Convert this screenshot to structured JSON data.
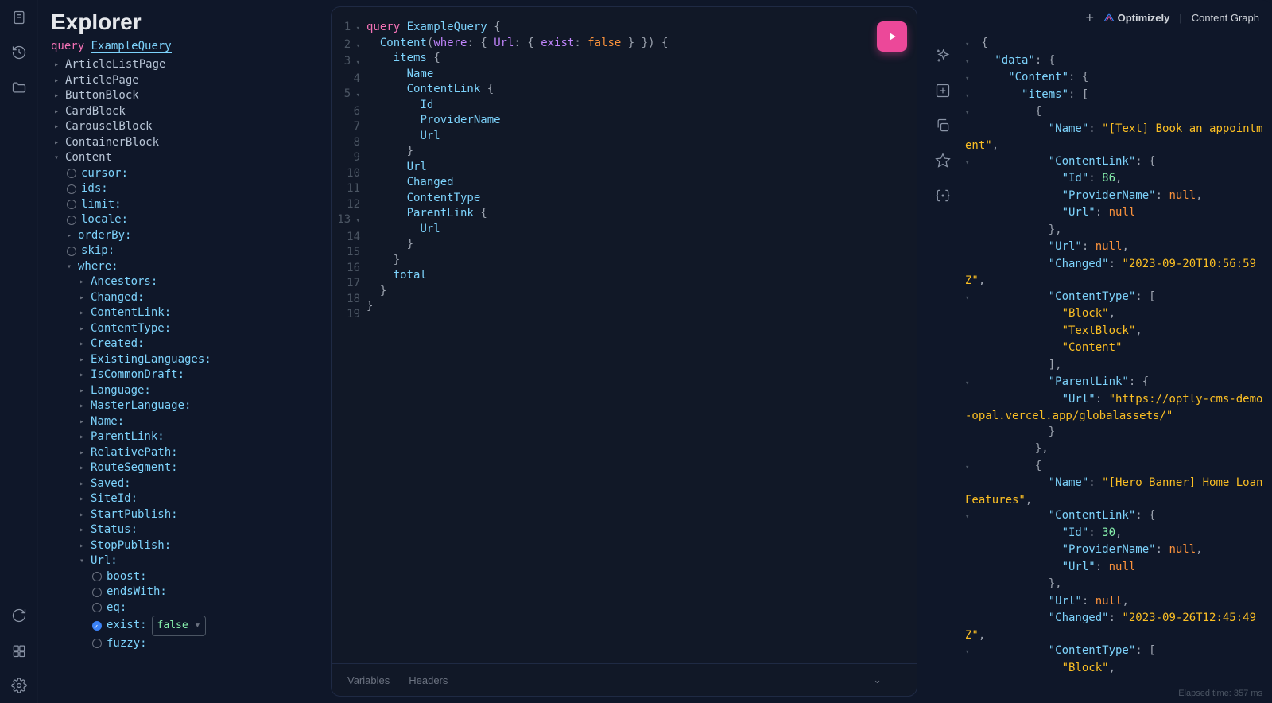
{
  "explorer": {
    "title": "Explorer",
    "query_keyword": "query",
    "query_name": "ExampleQuery",
    "types": [
      "ArticleListPage",
      "ArticlePage",
      "ButtonBlock",
      "CardBlock",
      "CarouselBlock",
      "ContainerBlock"
    ],
    "content_label": "Content",
    "content_args": [
      {
        "name": "cursor:",
        "checked": false
      },
      {
        "name": "ids:",
        "checked": false
      },
      {
        "name": "limit:",
        "checked": false
      },
      {
        "name": "locale:",
        "checked": false
      }
    ],
    "orderby": "orderBy:",
    "skip": {
      "name": "skip:",
      "checked": false
    },
    "where": "where:",
    "where_fields": [
      "Ancestors:",
      "Changed:",
      "ContentLink:",
      "ContentType:",
      "Created:",
      "ExistingLanguages:",
      "IsCommonDraft:",
      "Language:",
      "MasterLanguage:",
      "Name:",
      "ParentLink:",
      "RelativePath:",
      "RouteSegment:",
      "Saved:",
      "SiteId:",
      "StartPublish:",
      "Status:",
      "StopPublish:"
    ],
    "url_label": "Url:",
    "url_sub": [
      {
        "name": "boost:",
        "checked": false
      },
      {
        "name": "endsWith:",
        "checked": false
      },
      {
        "name": "eq:",
        "checked": false
      },
      {
        "name": "exist:",
        "checked": true,
        "value": "false"
      },
      {
        "name": "fuzzy:",
        "checked": false
      }
    ]
  },
  "editor": {
    "lines": [
      {
        "n": "1",
        "fold": true,
        "tokens": [
          {
            "c": "tk-kw",
            "t": "query"
          },
          {
            "c": "",
            "t": " "
          },
          {
            "c": "tk-name",
            "t": "ExampleQuery"
          },
          {
            "c": "",
            "t": " "
          },
          {
            "c": "tk-punc",
            "t": "{"
          }
        ]
      },
      {
        "n": "2",
        "fold": true,
        "tokens": [
          {
            "c": "",
            "t": "  "
          },
          {
            "c": "tk-field",
            "t": "Content"
          },
          {
            "c": "tk-punc",
            "t": "("
          },
          {
            "c": "tk-arg",
            "t": "where"
          },
          {
            "c": "tk-punc",
            "t": ": { "
          },
          {
            "c": "tk-arg",
            "t": "Url"
          },
          {
            "c": "tk-punc",
            "t": ": { "
          },
          {
            "c": "tk-arg",
            "t": "exist"
          },
          {
            "c": "tk-punc",
            "t": ": "
          },
          {
            "c": "tk-bool",
            "t": "false"
          },
          {
            "c": "tk-punc",
            "t": " } }) {"
          }
        ]
      },
      {
        "n": "3",
        "fold": true,
        "tokens": [
          {
            "c": "",
            "t": "    "
          },
          {
            "c": "tk-field",
            "t": "items"
          },
          {
            "c": "",
            "t": " "
          },
          {
            "c": "tk-punc",
            "t": "{"
          }
        ]
      },
      {
        "n": "4",
        "tokens": [
          {
            "c": "",
            "t": "      "
          },
          {
            "c": "tk-field",
            "t": "Name"
          }
        ]
      },
      {
        "n": "5",
        "fold": true,
        "tokens": [
          {
            "c": "",
            "t": "      "
          },
          {
            "c": "tk-field",
            "t": "ContentLink"
          },
          {
            "c": "",
            "t": " "
          },
          {
            "c": "tk-punc",
            "t": "{"
          }
        ]
      },
      {
        "n": "6",
        "tokens": [
          {
            "c": "",
            "t": "        "
          },
          {
            "c": "tk-field",
            "t": "Id"
          }
        ]
      },
      {
        "n": "7",
        "tokens": [
          {
            "c": "",
            "t": "        "
          },
          {
            "c": "tk-field",
            "t": "ProviderName"
          }
        ]
      },
      {
        "n": "8",
        "tokens": [
          {
            "c": "",
            "t": "        "
          },
          {
            "c": "tk-field",
            "t": "Url"
          }
        ]
      },
      {
        "n": "9",
        "tokens": [
          {
            "c": "",
            "t": "      "
          },
          {
            "c": "tk-punc",
            "t": "}"
          }
        ]
      },
      {
        "n": "10",
        "tokens": [
          {
            "c": "",
            "t": "      "
          },
          {
            "c": "tk-field",
            "t": "Url"
          }
        ]
      },
      {
        "n": "11",
        "tokens": [
          {
            "c": "",
            "t": "      "
          },
          {
            "c": "tk-field",
            "t": "Changed"
          }
        ]
      },
      {
        "n": "12",
        "tokens": [
          {
            "c": "",
            "t": "      "
          },
          {
            "c": "tk-field",
            "t": "ContentType"
          }
        ]
      },
      {
        "n": "13",
        "fold": true,
        "tokens": [
          {
            "c": "",
            "t": "      "
          },
          {
            "c": "tk-field",
            "t": "ParentLink"
          },
          {
            "c": "",
            "t": " "
          },
          {
            "c": "tk-punc",
            "t": "{"
          }
        ]
      },
      {
        "n": "14",
        "tokens": [
          {
            "c": "",
            "t": "        "
          },
          {
            "c": "tk-field",
            "t": "Url"
          }
        ]
      },
      {
        "n": "15",
        "tokens": [
          {
            "c": "",
            "t": "      "
          },
          {
            "c": "tk-punc",
            "t": "}"
          }
        ]
      },
      {
        "n": "16",
        "tokens": [
          {
            "c": "",
            "t": "    "
          },
          {
            "c": "tk-punc",
            "t": "}"
          }
        ]
      },
      {
        "n": "17",
        "tokens": [
          {
            "c": "",
            "t": "    "
          },
          {
            "c": "tk-field",
            "t": "total"
          }
        ]
      },
      {
        "n": "18",
        "tokens": [
          {
            "c": "",
            "t": "  "
          },
          {
            "c": "tk-punc",
            "t": "}"
          }
        ]
      },
      {
        "n": "19",
        "tokens": [
          {
            "c": "tk-punc",
            "t": "}"
          }
        ]
      }
    ]
  },
  "bottom": {
    "variables": "Variables",
    "headers": "Headers"
  },
  "branding": {
    "name": "Optimizely",
    "product": "Content Graph"
  },
  "result_lines": [
    [
      {
        "f": "▾"
      },
      {
        "c": "jp",
        "t": " {"
      }
    ],
    [
      {
        "f": "▾"
      },
      {
        "c": "jp",
        "t": "   "
      },
      {
        "c": "jk",
        "t": "\"data\""
      },
      {
        "c": "jp",
        "t": ": {"
      }
    ],
    [
      {
        "f": "▾"
      },
      {
        "c": "jp",
        "t": "     "
      },
      {
        "c": "jk",
        "t": "\"Content\""
      },
      {
        "c": "jp",
        "t": ": {"
      }
    ],
    [
      {
        "f": "▾"
      },
      {
        "c": "jp",
        "t": "       "
      },
      {
        "c": "jk",
        "t": "\"items\""
      },
      {
        "c": "jp",
        "t": ": ["
      }
    ],
    [
      {
        "f": "▾"
      },
      {
        "c": "jp",
        "t": "         {"
      }
    ],
    [
      {
        "f": " "
      },
      {
        "c": "jp",
        "t": "           "
      },
      {
        "c": "jk",
        "t": "\"Name\""
      },
      {
        "c": "jp",
        "t": ": "
      },
      {
        "c": "js",
        "t": "\"[Text] Book an appointment\""
      },
      {
        "c": "jp",
        "t": ","
      }
    ],
    [
      {
        "f": "▾"
      },
      {
        "c": "jp",
        "t": "           "
      },
      {
        "c": "jk",
        "t": "\"ContentLink\""
      },
      {
        "c": "jp",
        "t": ": {"
      }
    ],
    [
      {
        "f": " "
      },
      {
        "c": "jp",
        "t": "             "
      },
      {
        "c": "jk",
        "t": "\"Id\""
      },
      {
        "c": "jp",
        "t": ": "
      },
      {
        "c": "jn",
        "t": "86"
      },
      {
        "c": "jp",
        "t": ","
      }
    ],
    [
      {
        "f": " "
      },
      {
        "c": "jp",
        "t": "             "
      },
      {
        "c": "jk",
        "t": "\"ProviderName\""
      },
      {
        "c": "jp",
        "t": ": "
      },
      {
        "c": "jnull",
        "t": "null"
      },
      {
        "c": "jp",
        "t": ","
      }
    ],
    [
      {
        "f": " "
      },
      {
        "c": "jp",
        "t": "             "
      },
      {
        "c": "jk",
        "t": "\"Url\""
      },
      {
        "c": "jp",
        "t": ": "
      },
      {
        "c": "jnull",
        "t": "null"
      }
    ],
    [
      {
        "f": " "
      },
      {
        "c": "jp",
        "t": "           },"
      }
    ],
    [
      {
        "f": " "
      },
      {
        "c": "jp",
        "t": "           "
      },
      {
        "c": "jk",
        "t": "\"Url\""
      },
      {
        "c": "jp",
        "t": ": "
      },
      {
        "c": "jnull",
        "t": "null"
      },
      {
        "c": "jp",
        "t": ","
      }
    ],
    [
      {
        "f": " "
      },
      {
        "c": "jp",
        "t": "           "
      },
      {
        "c": "jk",
        "t": "\"Changed\""
      },
      {
        "c": "jp",
        "t": ": "
      },
      {
        "c": "js",
        "t": "\"2023-09-20T10:56:59Z\""
      },
      {
        "c": "jp",
        "t": ","
      }
    ],
    [
      {
        "f": "▾"
      },
      {
        "c": "jp",
        "t": "           "
      },
      {
        "c": "jk",
        "t": "\"ContentType\""
      },
      {
        "c": "jp",
        "t": ": ["
      }
    ],
    [
      {
        "f": " "
      },
      {
        "c": "jp",
        "t": "             "
      },
      {
        "c": "js",
        "t": "\"Block\""
      },
      {
        "c": "jp",
        "t": ","
      }
    ],
    [
      {
        "f": " "
      },
      {
        "c": "jp",
        "t": "             "
      },
      {
        "c": "js",
        "t": "\"TextBlock\""
      },
      {
        "c": "jp",
        "t": ","
      }
    ],
    [
      {
        "f": " "
      },
      {
        "c": "jp",
        "t": "             "
      },
      {
        "c": "js",
        "t": "\"Content\""
      }
    ],
    [
      {
        "f": " "
      },
      {
        "c": "jp",
        "t": "           ],"
      }
    ],
    [
      {
        "f": "▾"
      },
      {
        "c": "jp",
        "t": "           "
      },
      {
        "c": "jk",
        "t": "\"ParentLink\""
      },
      {
        "c": "jp",
        "t": ": {"
      }
    ],
    [
      {
        "f": " "
      },
      {
        "c": "jp",
        "t": "             "
      },
      {
        "c": "jk",
        "t": "\"Url\""
      },
      {
        "c": "jp",
        "t": ": "
      },
      {
        "c": "js",
        "t": "\"https://optly-cms-demo-opal.vercel.app/globalassets/\""
      }
    ],
    [
      {
        "f": " "
      },
      {
        "c": "jp",
        "t": "           }"
      }
    ],
    [
      {
        "f": " "
      },
      {
        "c": "jp",
        "t": "         },"
      }
    ],
    [
      {
        "f": "▾"
      },
      {
        "c": "jp",
        "t": "         {"
      }
    ],
    [
      {
        "f": " "
      },
      {
        "c": "jp",
        "t": "           "
      },
      {
        "c": "jk",
        "t": "\"Name\""
      },
      {
        "c": "jp",
        "t": ": "
      },
      {
        "c": "js",
        "t": "\"[Hero Banner] Home Loan Features\""
      },
      {
        "c": "jp",
        "t": ","
      }
    ],
    [
      {
        "f": "▾"
      },
      {
        "c": "jp",
        "t": "           "
      },
      {
        "c": "jk",
        "t": "\"ContentLink\""
      },
      {
        "c": "jp",
        "t": ": {"
      }
    ],
    [
      {
        "f": " "
      },
      {
        "c": "jp",
        "t": "             "
      },
      {
        "c": "jk",
        "t": "\"Id\""
      },
      {
        "c": "jp",
        "t": ": "
      },
      {
        "c": "jn",
        "t": "30"
      },
      {
        "c": "jp",
        "t": ","
      }
    ],
    [
      {
        "f": " "
      },
      {
        "c": "jp",
        "t": "             "
      },
      {
        "c": "jk",
        "t": "\"ProviderName\""
      },
      {
        "c": "jp",
        "t": ": "
      },
      {
        "c": "jnull",
        "t": "null"
      },
      {
        "c": "jp",
        "t": ","
      }
    ],
    [
      {
        "f": " "
      },
      {
        "c": "jp",
        "t": "             "
      },
      {
        "c": "jk",
        "t": "\"Url\""
      },
      {
        "c": "jp",
        "t": ": "
      },
      {
        "c": "jnull",
        "t": "null"
      }
    ],
    [
      {
        "f": " "
      },
      {
        "c": "jp",
        "t": "           },"
      }
    ],
    [
      {
        "f": " "
      },
      {
        "c": "jp",
        "t": "           "
      },
      {
        "c": "jk",
        "t": "\"Url\""
      },
      {
        "c": "jp",
        "t": ": "
      },
      {
        "c": "jnull",
        "t": "null"
      },
      {
        "c": "jp",
        "t": ","
      }
    ],
    [
      {
        "f": " "
      },
      {
        "c": "jp",
        "t": "           "
      },
      {
        "c": "jk",
        "t": "\"Changed\""
      },
      {
        "c": "jp",
        "t": ": "
      },
      {
        "c": "js",
        "t": "\"2023-09-26T12:45:49Z\""
      },
      {
        "c": "jp",
        "t": ","
      }
    ],
    [
      {
        "f": "▾"
      },
      {
        "c": "jp",
        "t": "           "
      },
      {
        "c": "jk",
        "t": "\"ContentType\""
      },
      {
        "c": "jp",
        "t": ": ["
      }
    ],
    [
      {
        "f": " "
      },
      {
        "c": "jp",
        "t": "             "
      },
      {
        "c": "js",
        "t": "\"Block\""
      },
      {
        "c": "jp",
        "t": ","
      }
    ]
  ],
  "footer": {
    "elapsed": "Elapsed time: 357 ms"
  }
}
